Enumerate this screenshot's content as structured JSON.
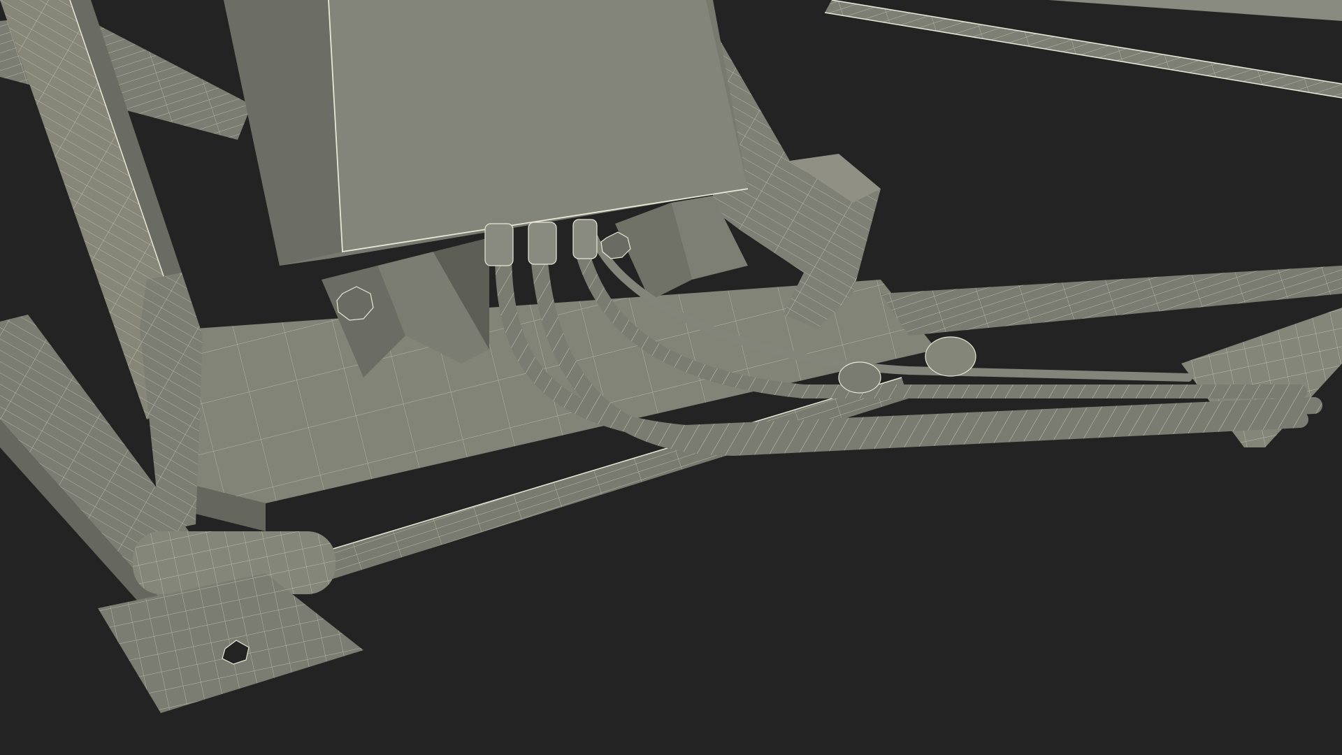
{
  "scene": {
    "background": "#232323",
    "surface_fill": "#7e7f74",
    "surface_light": "#8c8d82",
    "surface_dark": "#5f6058",
    "wire_color": "#e9e8d8"
  }
}
